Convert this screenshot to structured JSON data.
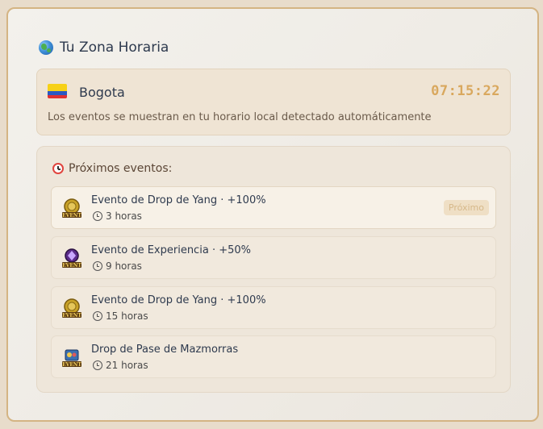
{
  "header": {
    "title": "Tu Zona Horaria",
    "icon": "globe-icon"
  },
  "timezone": {
    "city": "Bogota",
    "flag": "colombia-flag",
    "time": "07:15:22",
    "note": "Los eventos se muestran en tu horario local detectado automáticamente"
  },
  "events": {
    "heading": "Próximos eventos:",
    "heading_icon": "alarm-clock-icon",
    "items": [
      {
        "name": "Evento de Drop de Yang",
        "bonus": "· +100%",
        "time": "3 horas",
        "badge": "Próximo",
        "icon": "yang-event-icon"
      },
      {
        "name": "Evento de Experiencia",
        "bonus": "· +50%",
        "time": "9 horas",
        "icon": "experience-event-icon"
      },
      {
        "name": "Evento de Drop de Yang",
        "bonus": "· +100%",
        "time": "15 horas",
        "icon": "yang-event-icon"
      },
      {
        "name": "Drop de Pase de Mazmorras",
        "bonus": "",
        "time": "21 horas",
        "icon": "dungeon-pass-event-icon"
      }
    ]
  },
  "colors": {
    "accent": "#d9a85e",
    "border": "#d4b483",
    "text": "#2e3a4e"
  }
}
